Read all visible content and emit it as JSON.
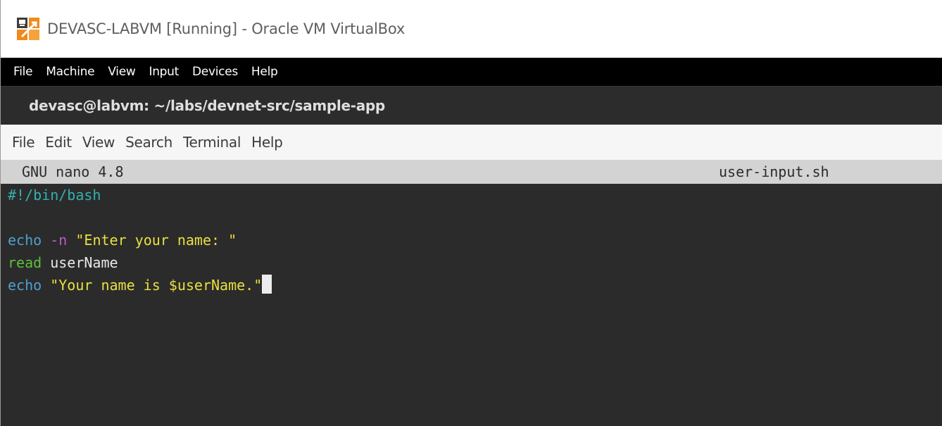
{
  "host_window": {
    "title": "DEVASC-LABVM [Running] - Oracle VM VirtualBox",
    "app_icon": "virtualbox-icon",
    "menu": [
      "File",
      "Machine",
      "View",
      "Input",
      "Devices",
      "Help"
    ]
  },
  "terminal": {
    "title": "devasc@labvm: ~/labs/devnet-src/sample-app",
    "menu": [
      "File",
      "Edit",
      "View",
      "Search",
      "Terminal",
      "Help"
    ]
  },
  "nano": {
    "version": "GNU nano 4.8",
    "filename": "user-input.sh"
  },
  "code": {
    "line1": "#!/bin/bash",
    "line3_cmd": "echo",
    "line3_flag": "-n",
    "line3_string": "\"Enter your name: \"",
    "line4_cmd": "read",
    "line4_arg": "userName",
    "line5_cmd": "echo",
    "line5_string": "\"Your name is $userName.\""
  },
  "colors": {
    "comment": "#33b0b0",
    "builtin": "#4f9fd0",
    "flag": "#c058c8",
    "string": "#e8e040",
    "read": "#5fbf3a",
    "terminal_bg": "#2b2b2b"
  }
}
